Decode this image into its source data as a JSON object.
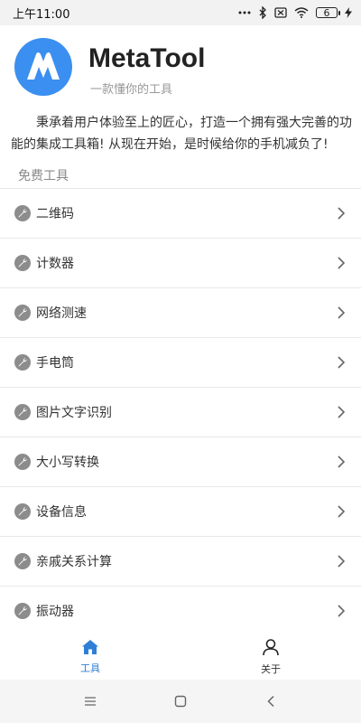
{
  "status_bar": {
    "time": "上午11:00",
    "battery": "6"
  },
  "header": {
    "title": "MetaTool",
    "subtitle": "一款懂你的工具",
    "logo_letter": "M",
    "logo_color": "#3b8ff0"
  },
  "intro": "秉承着用户体验至上的匠心，打造一个拥有强大完善的功能的集成工具箱! 从现在开始，是时候给你的手机减负了!",
  "section": {
    "title": "免费工具"
  },
  "tools": [
    {
      "label": "二维码"
    },
    {
      "label": "计数器"
    },
    {
      "label": "网络测速"
    },
    {
      "label": "手电筒"
    },
    {
      "label": "图片文字识别"
    },
    {
      "label": "大小写转换"
    },
    {
      "label": "设备信息"
    },
    {
      "label": "亲戚关系计算"
    },
    {
      "label": "振动器"
    }
  ],
  "tabs": [
    {
      "label": "工具",
      "icon": "home-icon",
      "active": true
    },
    {
      "label": "关于",
      "icon": "person-icon",
      "active": false
    }
  ],
  "colors": {
    "accent": "#2f7fd6",
    "icon_gray": "#8c8c8c"
  }
}
